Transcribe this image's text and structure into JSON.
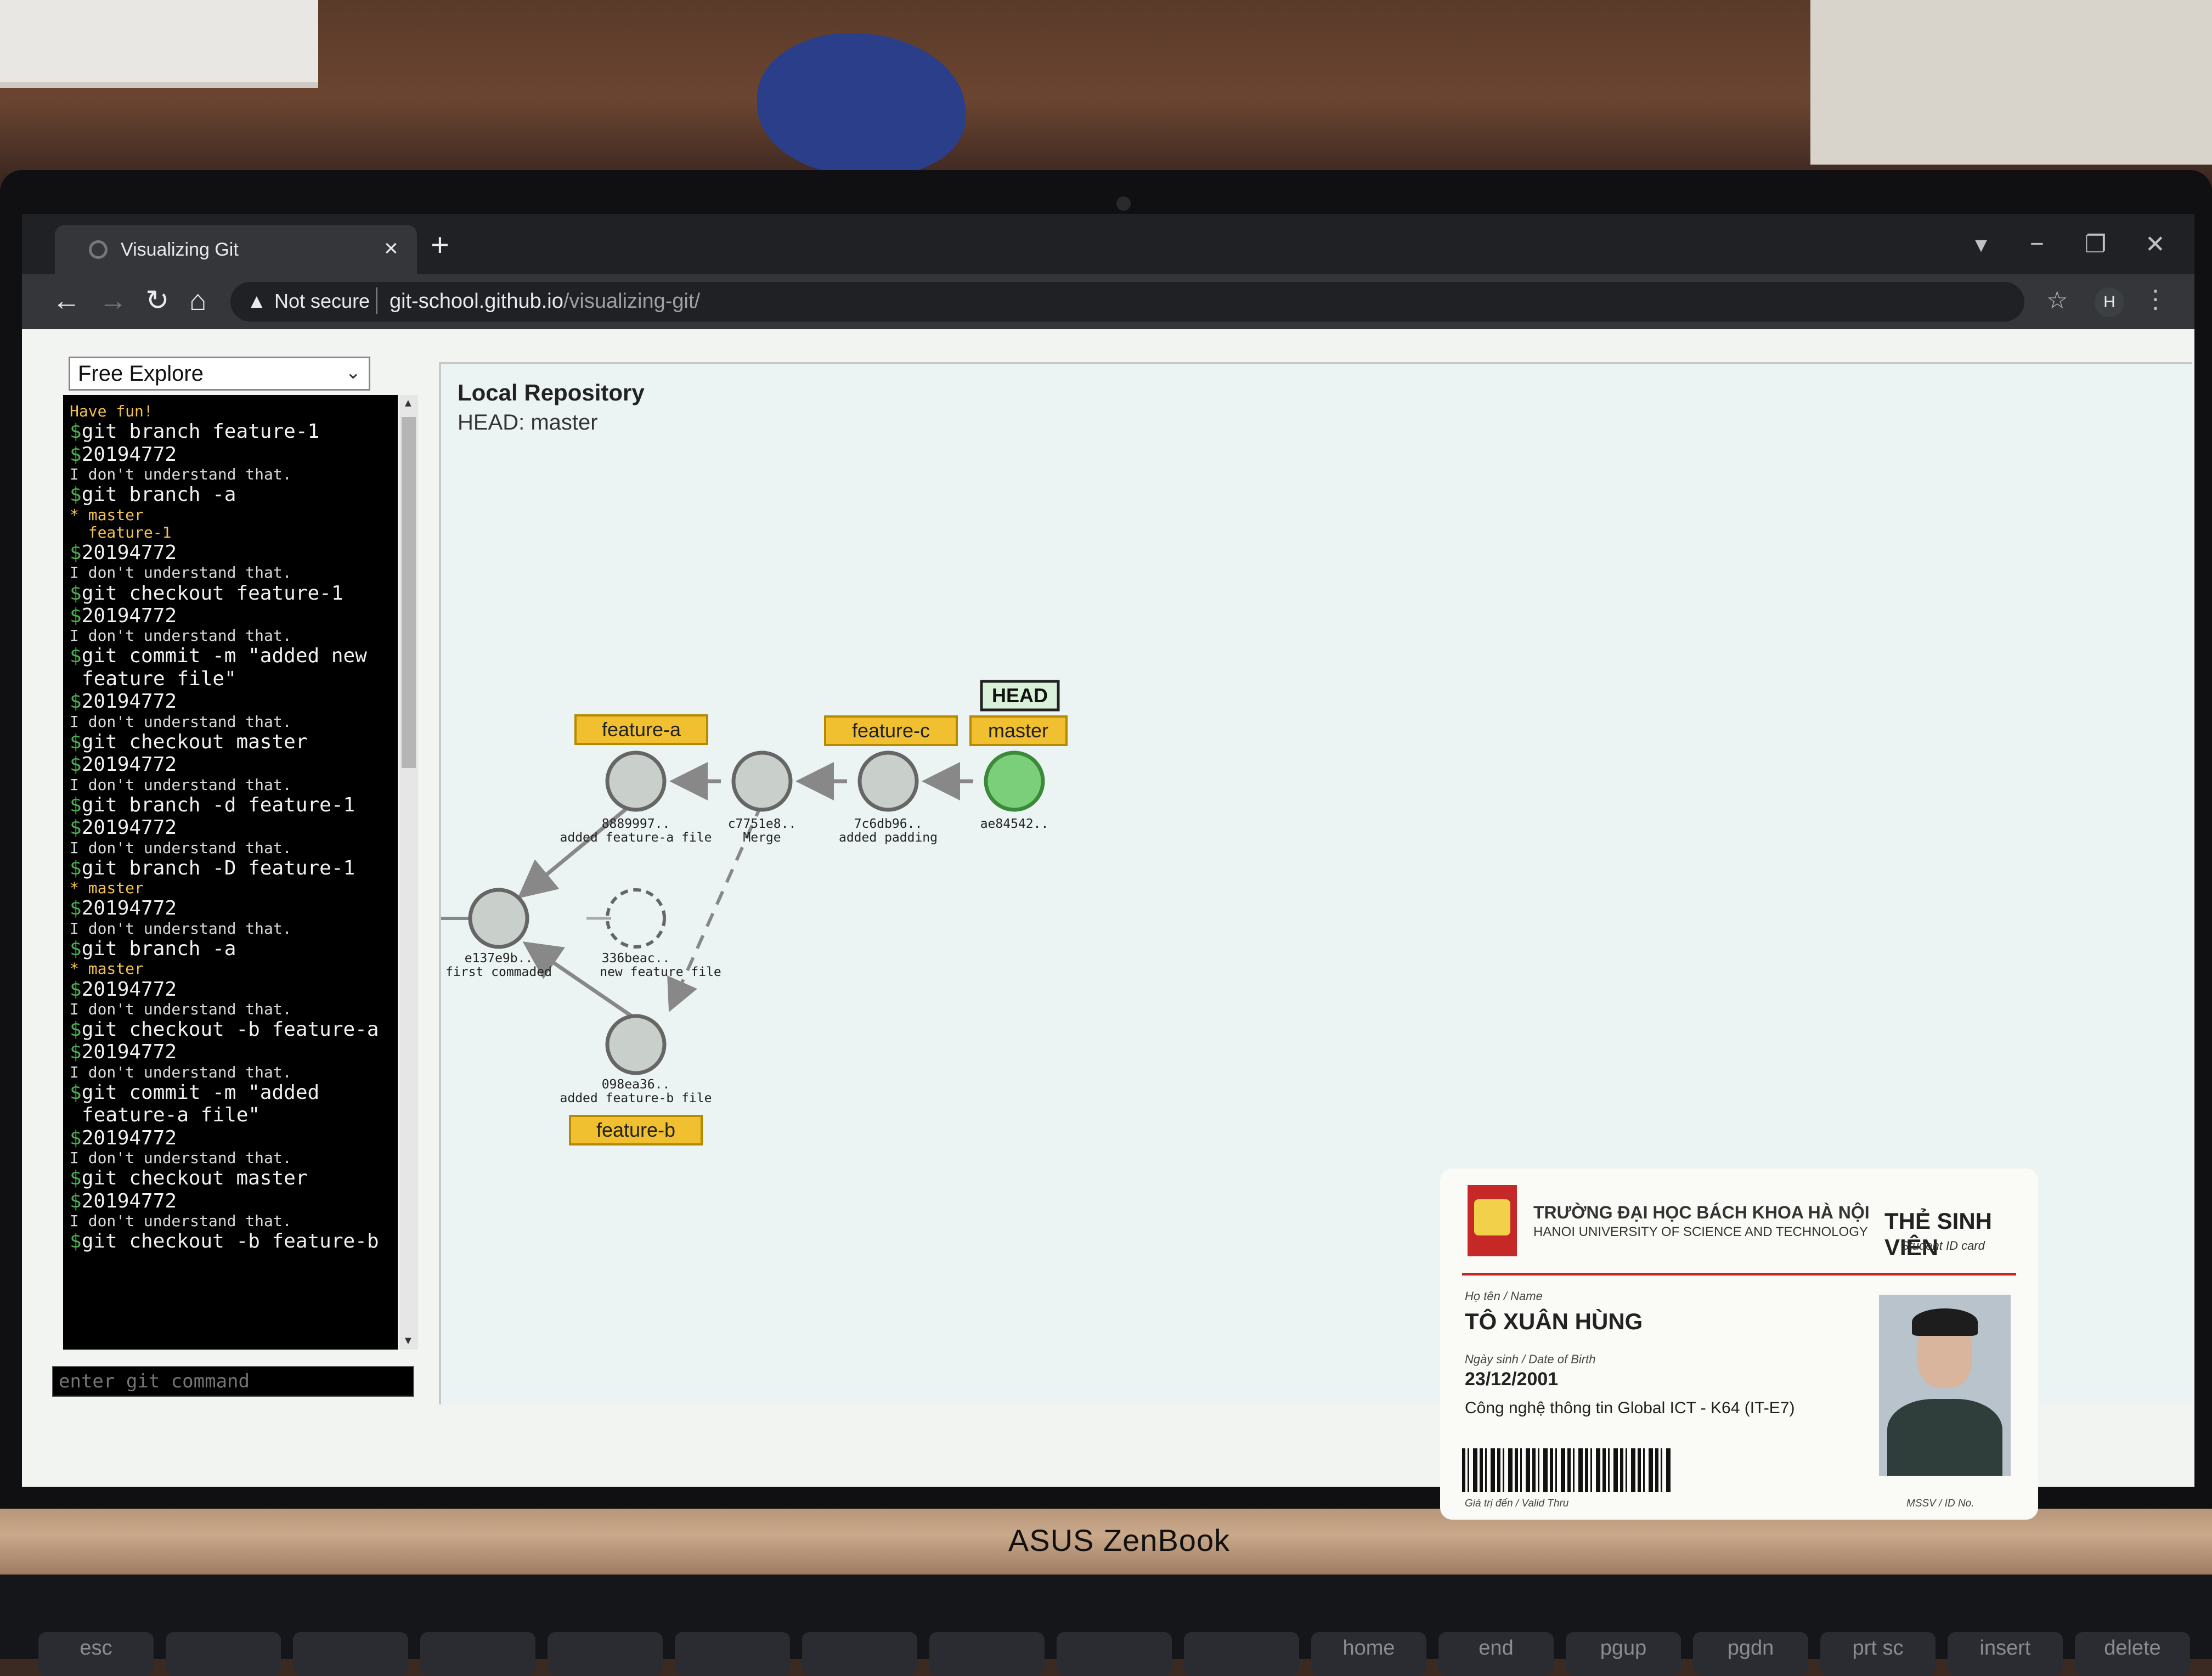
{
  "browser": {
    "tab_title": "Visualizing Git",
    "tab_close": "×",
    "new_tab": "+",
    "window_controls": {
      "profile_icon": "▾",
      "minimize": "−",
      "maximize": "❐",
      "close": "✕"
    },
    "nav": {
      "back": "←",
      "forward": "→",
      "reload": "↻",
      "home": "⌂"
    },
    "security_icon": "▲",
    "security_label": "Not secure",
    "url_host": "git-school.github.io",
    "url_path": "/visualizing-git/",
    "star": "☆",
    "avatar_letter": "H",
    "menu": "⋮"
  },
  "page": {
    "mode_select": {
      "value": "Free Explore",
      "chevron": "⌄"
    },
    "console_lines": [
      {
        "kind": "info",
        "text": "Have fun!"
      },
      {
        "kind": "cmd",
        "text": "git branch feature-1"
      },
      {
        "kind": "cmd",
        "text": "20194772"
      },
      {
        "kind": "err",
        "text": "I don't understand that."
      },
      {
        "kind": "cmd",
        "text": "git branch -a"
      },
      {
        "kind": "out",
        "text": "* master"
      },
      {
        "kind": "out",
        "text": "  feature-1"
      },
      {
        "kind": "cmd",
        "text": "20194772"
      },
      {
        "kind": "err",
        "text": "I don't understand that."
      },
      {
        "kind": "cmd",
        "text": "git checkout feature-1"
      },
      {
        "kind": "cmd",
        "text": "20194772"
      },
      {
        "kind": "err",
        "text": "I don't understand that."
      },
      {
        "kind": "cmd",
        "text": "git commit -m \"added new"
      },
      {
        "kind": "cont",
        "text": "feature file\""
      },
      {
        "kind": "cmd",
        "text": "20194772"
      },
      {
        "kind": "err",
        "text": "I don't understand that."
      },
      {
        "kind": "cmd",
        "text": "git checkout master"
      },
      {
        "kind": "cmd",
        "text": "20194772"
      },
      {
        "kind": "err",
        "text": "I don't understand that."
      },
      {
        "kind": "cmd",
        "text": "git branch -d feature-1"
      },
      {
        "kind": "cmd",
        "text": "20194772"
      },
      {
        "kind": "err",
        "text": "I don't understand that."
      },
      {
        "kind": "cmd",
        "text": "git branch -D feature-1"
      },
      {
        "kind": "out",
        "text": "* master"
      },
      {
        "kind": "cmd",
        "text": "20194772"
      },
      {
        "kind": "err",
        "text": "I don't understand that."
      },
      {
        "kind": "cmd",
        "text": "git branch -a"
      },
      {
        "kind": "out",
        "text": "* master"
      },
      {
        "kind": "cmd",
        "text": "20194772"
      },
      {
        "kind": "err",
        "text": "I don't understand that."
      },
      {
        "kind": "cmd",
        "text": "git checkout -b feature-a"
      },
      {
        "kind": "cmd",
        "text": "20194772"
      },
      {
        "kind": "err",
        "text": "I don't understand that."
      },
      {
        "kind": "cmd",
        "text": "git commit -m \"added"
      },
      {
        "kind": "cont",
        "text": "feature-a file\""
      },
      {
        "kind": "cmd",
        "text": "20194772"
      },
      {
        "kind": "err",
        "text": "I don't understand that."
      },
      {
        "kind": "cmd",
        "text": "git checkout master"
      },
      {
        "kind": "cmd",
        "text": "20194772"
      },
      {
        "kind": "err",
        "text": "I don't understand that."
      },
      {
        "kind": "cmd",
        "text": "git checkout -b feature-b"
      }
    ],
    "prompt_symbol": "$",
    "command_input_placeholder": "enter git command",
    "repo": {
      "title": "Local Repository",
      "head_label": "HEAD: master",
      "head_tag": "HEAD",
      "branches": [
        "feature-a",
        "feature-c",
        "master",
        "feature-b"
      ],
      "commits": [
        {
          "id": "e137e9b..",
          "message": "first commaded"
        },
        {
          "id": "336beac..",
          "message": "new feature file"
        },
        {
          "id": "8889997..",
          "message": "added feature-a file"
        },
        {
          "id": "c7751e8..",
          "message": "Merge"
        },
        {
          "id": "7c6db96..",
          "message": "added padding"
        },
        {
          "id": "ae84542..",
          "message": ""
        },
        {
          "id": "098ea36..",
          "message": "added feature-b file"
        }
      ]
    }
  },
  "laptop": {
    "brand": "ASUS ZenBook",
    "keys": [
      "esc",
      "",
      "",
      "",
      "",
      "",
      "",
      "",
      "",
      "",
      "home",
      "end",
      "pgup",
      "pgdn",
      "prt sc",
      "insert",
      "delete"
    ]
  },
  "id_card": {
    "school_name_vi": "TRƯỜNG ĐẠI HỌC BÁCH KHOA HÀ NỘI",
    "school_name_en": "HANOI UNIVERSITY OF SCIENCE AND TECHNOLOGY",
    "card_type_vi": "THẺ SINH VIÊN",
    "card_type_en": "Student ID card",
    "name_label": "Họ tên / Name",
    "name": "TÔ XUÂN HÙNG",
    "dob_label": "Ngày sinh / Date of Birth",
    "dob": "23/12/2001",
    "program": "Công nghệ thông tin Global ICT - K64 (IT-E7)",
    "valid_label": "Giá trị đến / Valid Thru",
    "id_label": "MSSV / ID No."
  },
  "colors": {
    "branch_tag": "#f0c030",
    "head_commit": "#4caf50",
    "commit": "#c9d0cc",
    "console_bg": "#000000"
  }
}
